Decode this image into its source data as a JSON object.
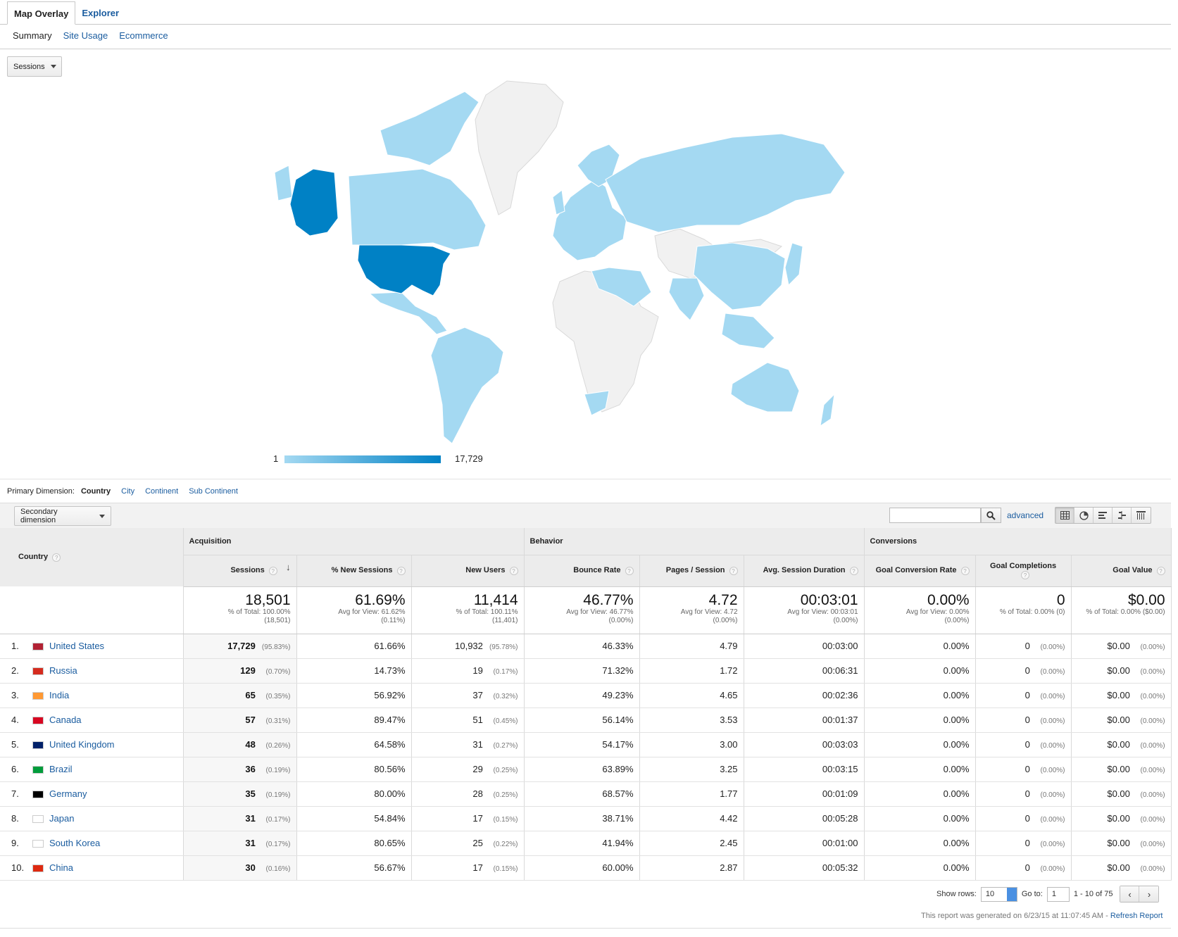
{
  "tabs": {
    "map_overlay": "Map Overlay",
    "explorer": "Explorer"
  },
  "subtabs": {
    "summary": "Summary",
    "site_usage": "Site Usage",
    "ecommerce": "Ecommerce"
  },
  "metric_selector": "Sessions",
  "legend": {
    "min": "1",
    "max": "17,729"
  },
  "colors": {
    "high": "#0081c5",
    "low": "#a4d9f2",
    "no_data": "#f1f1f1",
    "link": "#1a5c9f"
  },
  "dimension": {
    "label": "Primary Dimension:",
    "current": "Country",
    "options": [
      "City",
      "Continent",
      "Sub Continent"
    ]
  },
  "secondary_dimension": "Secondary dimension",
  "advanced": "advanced",
  "groups": {
    "acquisition": "Acquisition",
    "behavior": "Behavior",
    "conversions": "Conversions"
  },
  "columns": {
    "country": "Country",
    "sessions": "Sessions",
    "new_sessions": "% New Sessions",
    "new_users": "New Users",
    "bounce": "Bounce Rate",
    "pages": "Pages / Session",
    "duration": "Avg. Session Duration",
    "gcr": "Goal Conversion Rate",
    "gc": "Goal Completions",
    "gv": "Goal Value"
  },
  "totals": {
    "sessions": {
      "value": "18,501",
      "sub1": "% of Total: 100.00%",
      "sub2": "(18,501)"
    },
    "new_sessions": {
      "value": "61.69%",
      "sub1": "Avg for View: 61.62%",
      "sub2": "(0.11%)"
    },
    "new_users": {
      "value": "11,414",
      "sub1": "% of Total: 100.11%",
      "sub2": "(11,401)"
    },
    "bounce": {
      "value": "46.77%",
      "sub1": "Avg for View: 46.77%",
      "sub2": "(0.00%)"
    },
    "pages": {
      "value": "4.72",
      "sub1": "Avg for View: 4.72",
      "sub2": "(0.00%)"
    },
    "duration": {
      "value": "00:03:01",
      "sub1": "Avg for View: 00:03:01",
      "sub2": "(0.00%)"
    },
    "gcr": {
      "value": "0.00%",
      "sub1": "Avg for View: 0.00%",
      "sub2": "(0.00%)"
    },
    "gc": {
      "value": "0",
      "sub1": "% of Total: 0.00% (0)",
      "sub2": ""
    },
    "gv": {
      "value": "$0.00",
      "sub1": "% of Total: 0.00% ($0.00)",
      "sub2": ""
    }
  },
  "rows": [
    {
      "idx": "1.",
      "country": "United States",
      "sessions": "17,729",
      "sessions_pct": "(95.83%)",
      "new_sessions": "61.66%",
      "new_users": "10,932",
      "new_users_pct": "(95.78%)",
      "bounce": "46.33%",
      "pages": "4.79",
      "duration": "00:03:00",
      "gcr": "0.00%",
      "gc": "0",
      "gc_pct": "(0.00%)",
      "gv": "$0.00",
      "gv_pct": "(0.00%)"
    },
    {
      "idx": "2.",
      "country": "Russia",
      "sessions": "129",
      "sessions_pct": "(0.70%)",
      "new_sessions": "14.73%",
      "new_users": "19",
      "new_users_pct": "(0.17%)",
      "bounce": "71.32%",
      "pages": "1.72",
      "duration": "00:06:31",
      "gcr": "0.00%",
      "gc": "0",
      "gc_pct": "(0.00%)",
      "gv": "$0.00",
      "gv_pct": "(0.00%)"
    },
    {
      "idx": "3.",
      "country": "India",
      "sessions": "65",
      "sessions_pct": "(0.35%)",
      "new_sessions": "56.92%",
      "new_users": "37",
      "new_users_pct": "(0.32%)",
      "bounce": "49.23%",
      "pages": "4.65",
      "duration": "00:02:36",
      "gcr": "0.00%",
      "gc": "0",
      "gc_pct": "(0.00%)",
      "gv": "$0.00",
      "gv_pct": "(0.00%)"
    },
    {
      "idx": "4.",
      "country": "Canada",
      "sessions": "57",
      "sessions_pct": "(0.31%)",
      "new_sessions": "89.47%",
      "new_users": "51",
      "new_users_pct": "(0.45%)",
      "bounce": "56.14%",
      "pages": "3.53",
      "duration": "00:01:37",
      "gcr": "0.00%",
      "gc": "0",
      "gc_pct": "(0.00%)",
      "gv": "$0.00",
      "gv_pct": "(0.00%)"
    },
    {
      "idx": "5.",
      "country": "United Kingdom",
      "sessions": "48",
      "sessions_pct": "(0.26%)",
      "new_sessions": "64.58%",
      "new_users": "31",
      "new_users_pct": "(0.27%)",
      "bounce": "54.17%",
      "pages": "3.00",
      "duration": "00:03:03",
      "gcr": "0.00%",
      "gc": "0",
      "gc_pct": "(0.00%)",
      "gv": "$0.00",
      "gv_pct": "(0.00%)"
    },
    {
      "idx": "6.",
      "country": "Brazil",
      "sessions": "36",
      "sessions_pct": "(0.19%)",
      "new_sessions": "80.56%",
      "new_users": "29",
      "new_users_pct": "(0.25%)",
      "bounce": "63.89%",
      "pages": "3.25",
      "duration": "00:03:15",
      "gcr": "0.00%",
      "gc": "0",
      "gc_pct": "(0.00%)",
      "gv": "$0.00",
      "gv_pct": "(0.00%)"
    },
    {
      "idx": "7.",
      "country": "Germany",
      "sessions": "35",
      "sessions_pct": "(0.19%)",
      "new_sessions": "80.00%",
      "new_users": "28",
      "new_users_pct": "(0.25%)",
      "bounce": "68.57%",
      "pages": "1.77",
      "duration": "00:01:09",
      "gcr": "0.00%",
      "gc": "0",
      "gc_pct": "(0.00%)",
      "gv": "$0.00",
      "gv_pct": "(0.00%)"
    },
    {
      "idx": "8.",
      "country": "Japan",
      "sessions": "31",
      "sessions_pct": "(0.17%)",
      "new_sessions": "54.84%",
      "new_users": "17",
      "new_users_pct": "(0.15%)",
      "bounce": "38.71%",
      "pages": "4.42",
      "duration": "00:05:28",
      "gcr": "0.00%",
      "gc": "0",
      "gc_pct": "(0.00%)",
      "gv": "$0.00",
      "gv_pct": "(0.00%)"
    },
    {
      "idx": "9.",
      "country": "South Korea",
      "sessions": "31",
      "sessions_pct": "(0.17%)",
      "new_sessions": "80.65%",
      "new_users": "25",
      "new_users_pct": "(0.22%)",
      "bounce": "41.94%",
      "pages": "2.45",
      "duration": "00:01:00",
      "gcr": "0.00%",
      "gc": "0",
      "gc_pct": "(0.00%)",
      "gv": "$0.00",
      "gv_pct": "(0.00%)"
    },
    {
      "idx": "10.",
      "country": "China",
      "sessions": "30",
      "sessions_pct": "(0.16%)",
      "new_sessions": "56.67%",
      "new_users": "17",
      "new_users_pct": "(0.15%)",
      "bounce": "60.00%",
      "pages": "2.87",
      "duration": "00:05:32",
      "gcr": "0.00%",
      "gc": "0",
      "gc_pct": "(0.00%)",
      "gv": "$0.00",
      "gv_pct": "(0.00%)"
    }
  ],
  "footer": {
    "show_rows_label": "Show rows:",
    "show_rows_value": "10",
    "goto_label": "Go to:",
    "goto_value": "1",
    "range": "1 - 10 of 75",
    "generated": "This report was generated on 6/23/15 at 11:07:45 AM -",
    "refresh": "Refresh Report"
  }
}
